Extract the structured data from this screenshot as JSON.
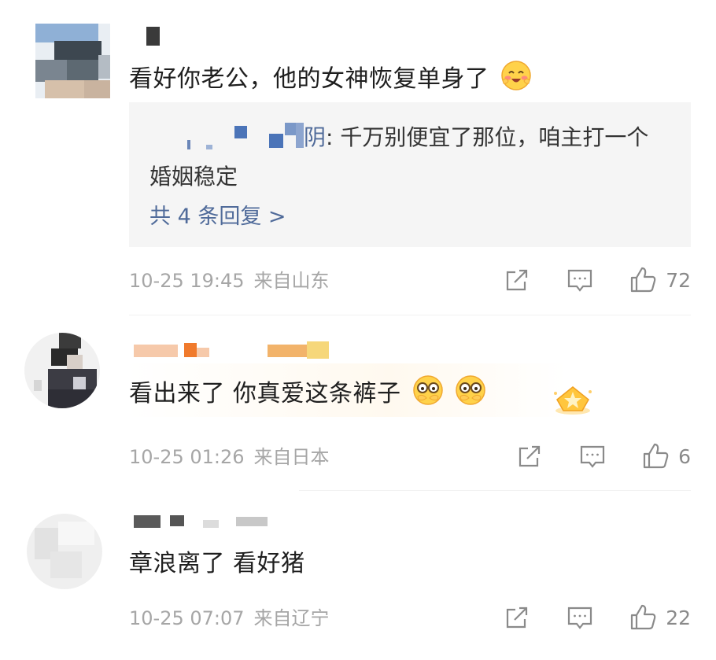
{
  "comments": [
    {
      "text": "看好你老公，他的女神恢复单身了",
      "emoji": "blush-emoji",
      "reply": {
        "name_suffix": "阴",
        "text": ": 千万别便宜了那位，咱主打一个婚姻稳定",
        "more_label": "共 4 条回复 >"
      },
      "time": "10-25 19:45",
      "location": "来自山东",
      "likes": "72"
    },
    {
      "text": "看出来了 你真爱这条裤子",
      "emoji": "peek-emoji",
      "badge": "star-badge-icon",
      "time": "10-25 01:26",
      "location": "来自日本",
      "likes": "6"
    },
    {
      "text": "章浪离了 看好猪",
      "time": "10-25 07:07",
      "location": "来自辽宁",
      "likes": "22"
    }
  ],
  "icons": [
    "share-icon",
    "comment-icon",
    "like-icon"
  ],
  "colors": {
    "text": "#1f1f1f",
    "meta": "#a6a6a6",
    "link": "#506b9a",
    "reply_bg": "#f5f5f5"
  }
}
